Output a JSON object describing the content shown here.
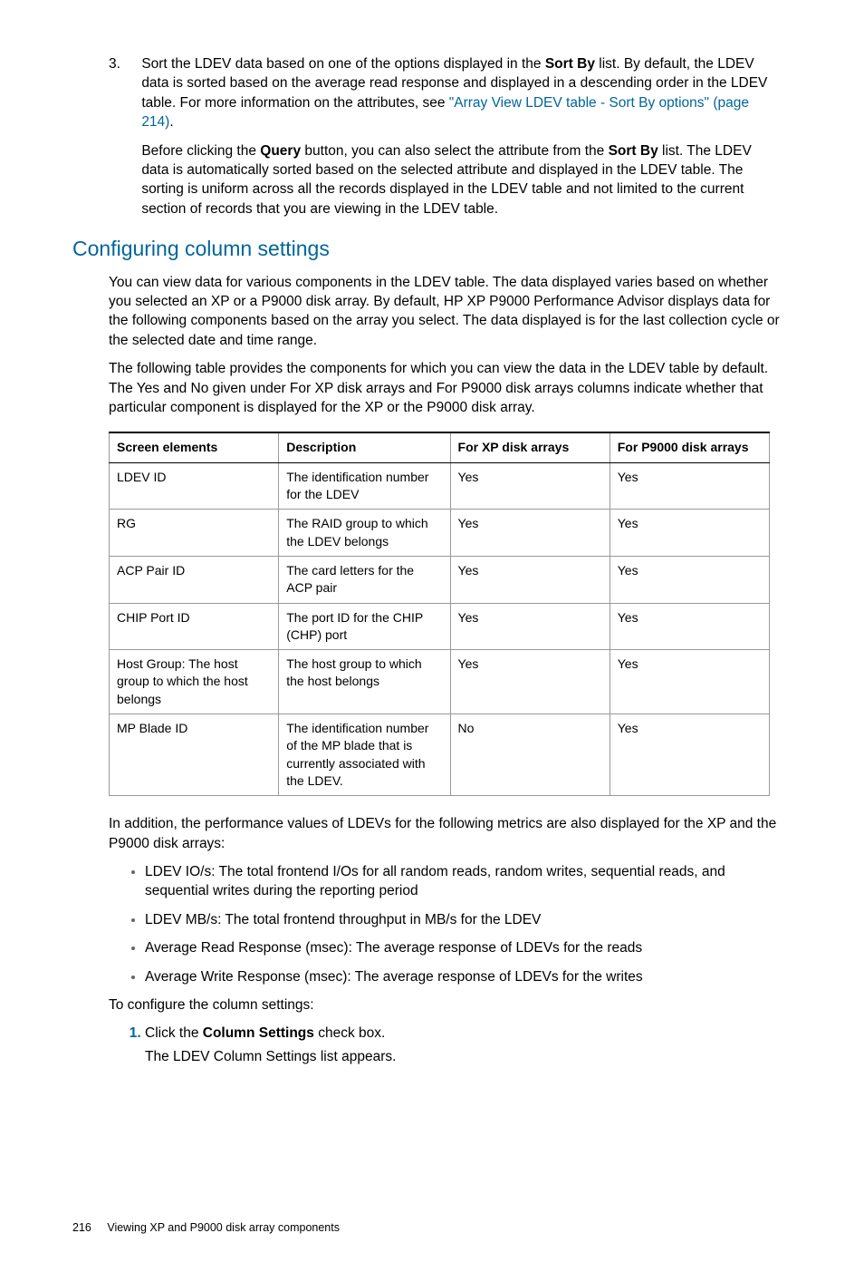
{
  "step3": {
    "num": "3.",
    "p1a": "Sort the LDEV data based on one of the options displayed in the ",
    "p1b": "Sort By",
    "p1c": " list. By default, the LDEV data is sorted based on the average read response and displayed in a descending order in the LDEV table. For more information on the attributes, see ",
    "link": "\"Array View LDEV table - Sort By options\" (page 214)",
    "p1d": ".",
    "p2a": "Before clicking the ",
    "p2b": "Query",
    "p2c": " button, you can also select the attribute from the ",
    "p2d": "Sort By",
    "p2e": " list. The LDEV data is automatically sorted based on the selected attribute and displayed in the LDEV table. The sorting is uniform across all the records displayed in the LDEV table and not limited to the current section of records that you are viewing in the LDEV table."
  },
  "heading": "Configuring column settings",
  "para1": "You can view data for various components in the LDEV table. The data displayed varies based on whether you selected an XP or a P9000 disk array. By default, HP XP P9000 Performance Advisor displays data for the following components based on the array you select. The data displayed is for the last collection cycle or the selected date and time range.",
  "para2": "The following table provides the components for which you can view the data in the LDEV table by default. The Yes and No given under For XP disk arrays and For P9000 disk arrays columns indicate whether that particular component is displayed for the XP or the P9000 disk array.",
  "table": {
    "h1": "Screen elements",
    "h2": "Description",
    "h3": "For XP disk arrays",
    "h4": "For P9000 disk arrays",
    "rows": [
      {
        "c1": "LDEV ID",
        "c2": "The identification number for the LDEV",
        "c3": "Yes",
        "c4": "Yes"
      },
      {
        "c1": "RG",
        "c2": "The RAID group to which the LDEV belongs",
        "c3": "Yes",
        "c4": "Yes"
      },
      {
        "c1": "ACP Pair ID",
        "c2": "The card letters for the ACP pair",
        "c3": "Yes",
        "c4": "Yes"
      },
      {
        "c1": "CHIP Port ID",
        "c2": "The port ID for the CHIP (CHP) port",
        "c3": "Yes",
        "c4": "Yes"
      },
      {
        "c1": "Host Group: The host group to which the host belongs",
        "c2": "The host group to which the host belongs",
        "c3": "Yes",
        "c4": "Yes"
      },
      {
        "c1": "MP Blade ID",
        "c2": "The identification number of the MP blade that is currently associated with the LDEV.",
        "c3": "No",
        "c4": "Yes"
      }
    ]
  },
  "para3": "In addition, the performance values of LDEVs for the following metrics are also displayed for the XP and the P9000 disk arrays:",
  "bullets": [
    "LDEV IO/s: The total frontend I/Os for all random reads, random writes, sequential reads, and sequential writes during the reporting period",
    "LDEV MB/s: The total frontend throughput in MB/s for the LDEV",
    "Average Read Response (msec): The average response of LDEVs for the reads",
    "Average Write Response (msec): The average response of LDEVs for the writes"
  ],
  "para4": "To configure the column settings:",
  "ol1": {
    "a": "Click the ",
    "b": "Column Settings",
    "c": " check box.",
    "d": "The LDEV Column Settings list appears."
  },
  "footer": {
    "page": "216",
    "title": "Viewing XP and P9000 disk array components"
  }
}
